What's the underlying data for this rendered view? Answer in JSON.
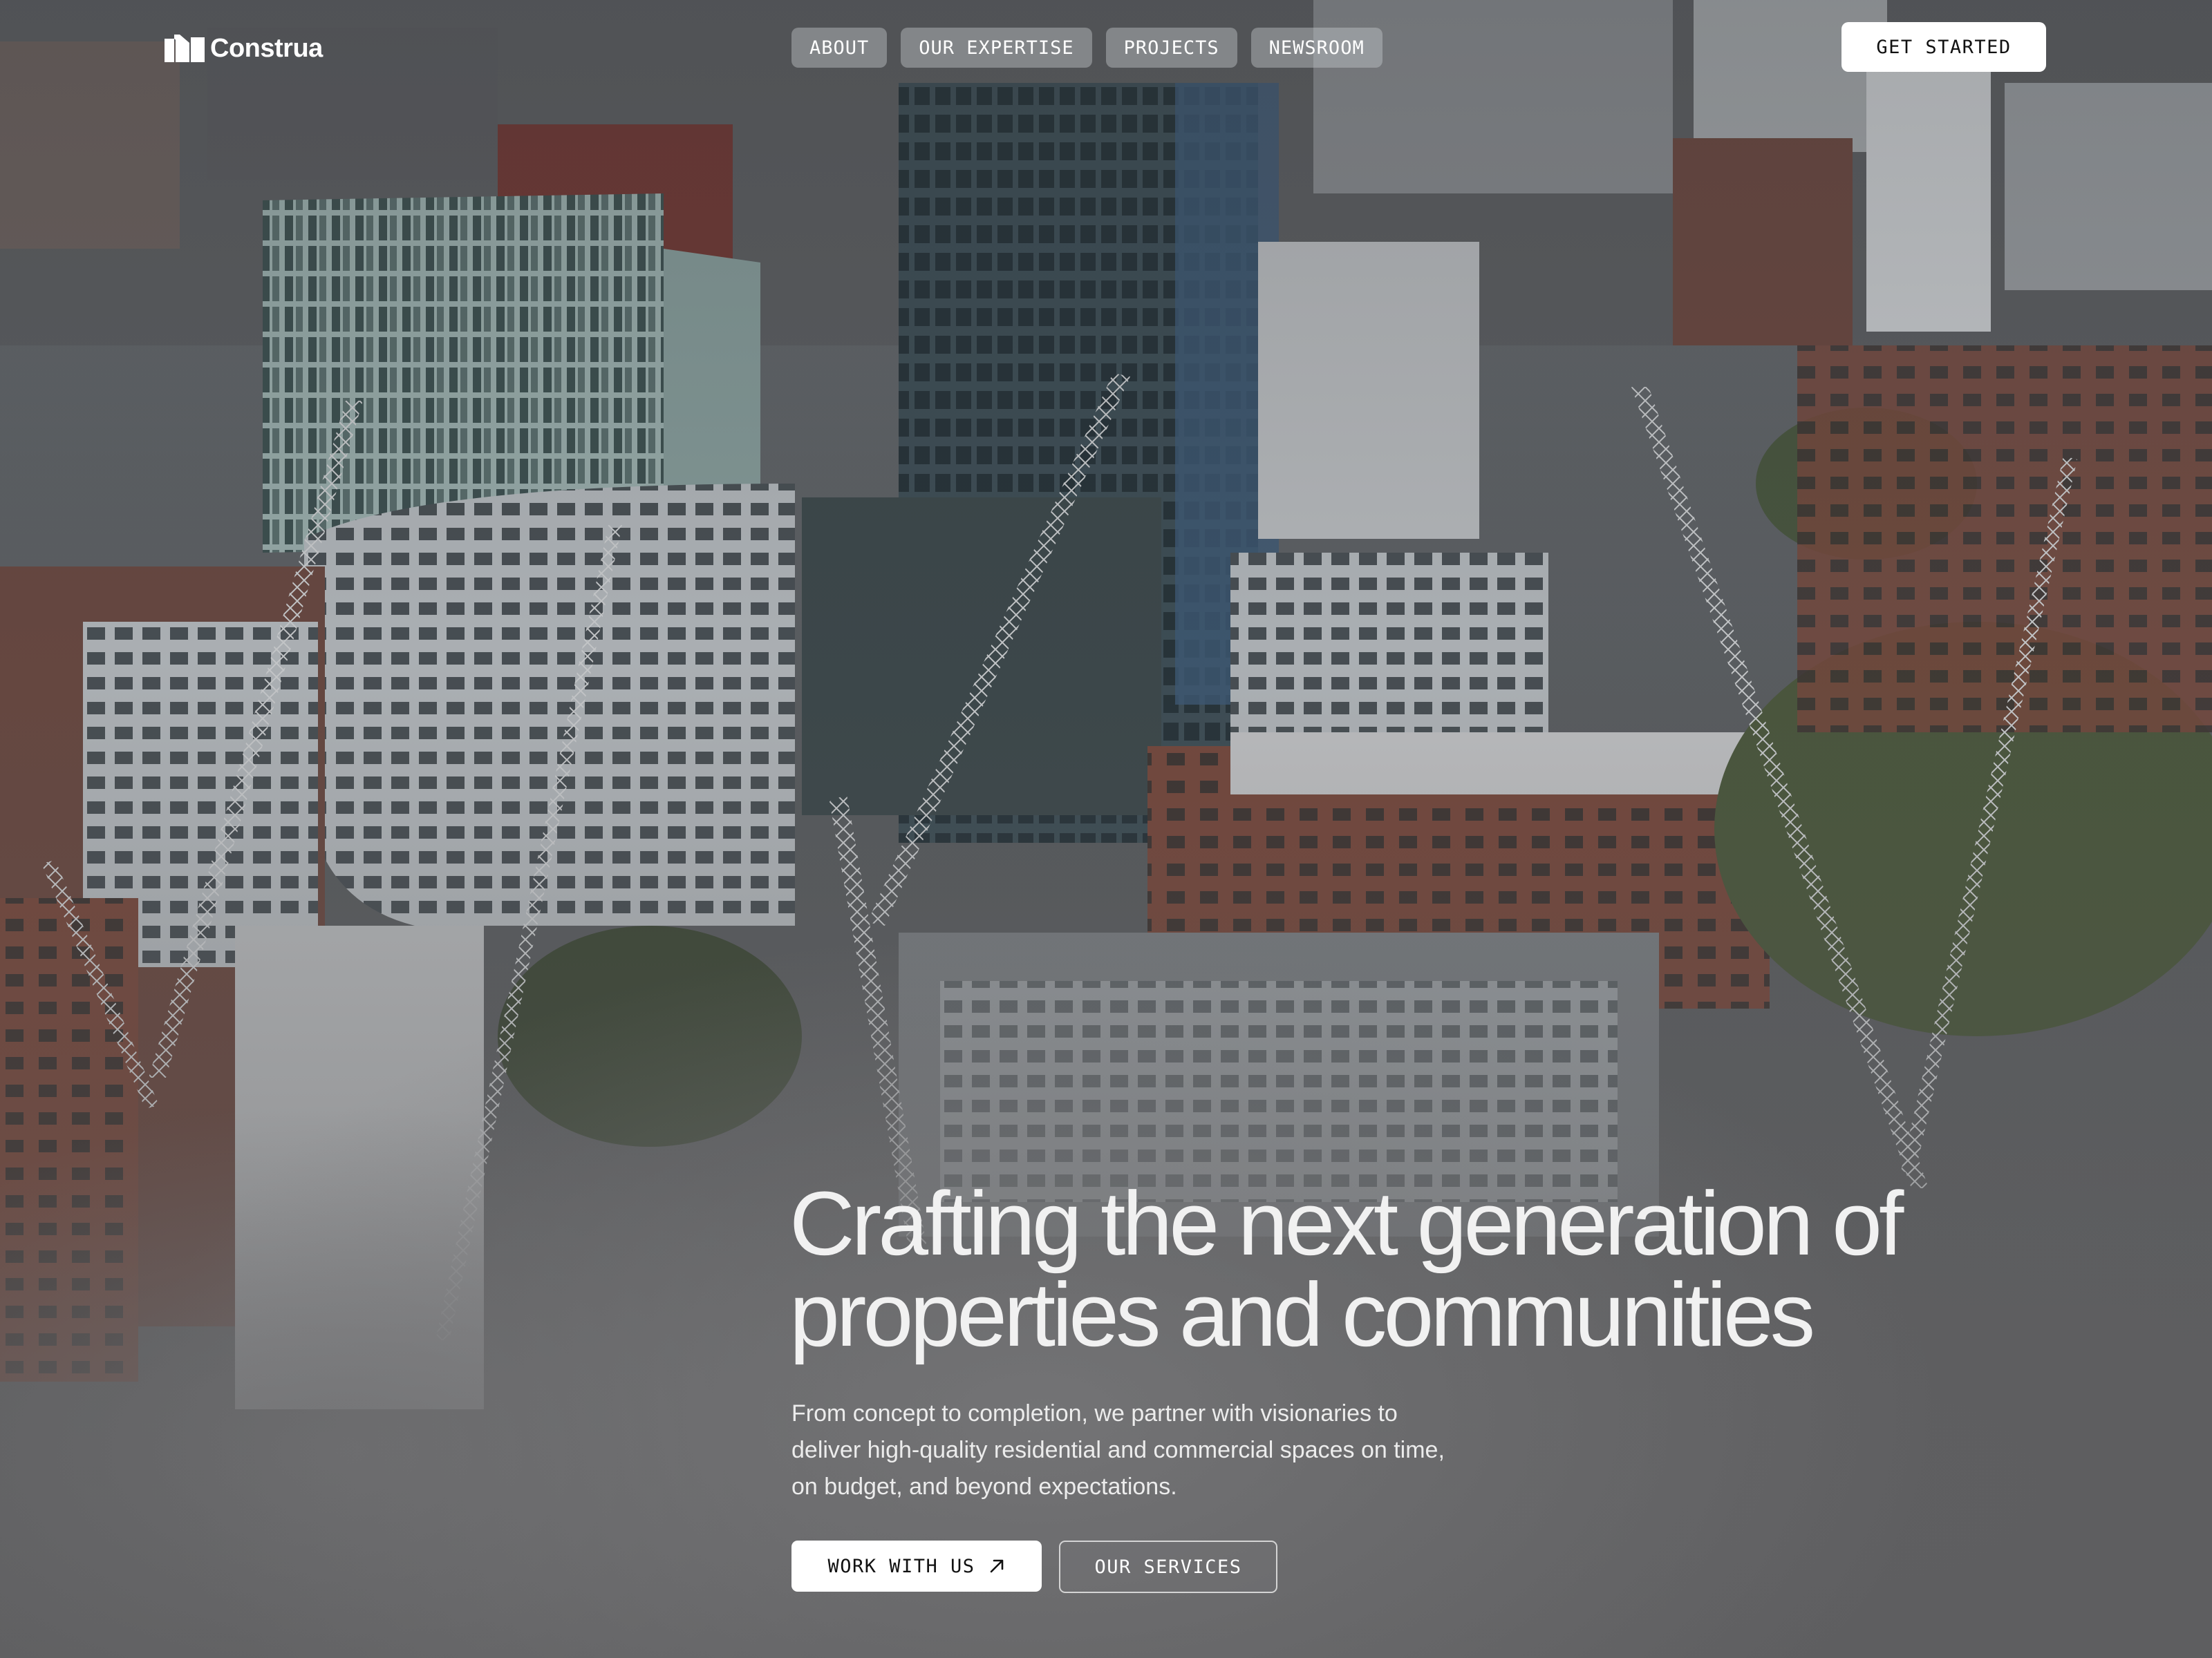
{
  "brand": {
    "name": "Construa",
    "logo_icon": "construa-logo-mark"
  },
  "nav": {
    "items": [
      {
        "label": "ABOUT"
      },
      {
        "label": "OUR EXPERTISE"
      },
      {
        "label": "PROJECTS"
      },
      {
        "label": "NEWSROOM"
      }
    ],
    "cta_label": "GET STARTED"
  },
  "hero": {
    "background": "aerial-city-construction-photo",
    "headline": "Crafting the next generation of properties and communities",
    "subcopy": "From concept to completion, we partner with visionaries to deliver high-quality residential and commercial spaces on time, on budget, and beyond expectations.",
    "primary_cta": {
      "label": "WORK WITH US",
      "icon": "arrow-up-right-icon"
    },
    "secondary_cta": {
      "label": "OUR SERVICES"
    }
  },
  "colors": {
    "text": "#ffffff",
    "button_bg": "#ffffff",
    "button_text": "#111111",
    "nav_pill_bg": "#c8ccd0"
  }
}
